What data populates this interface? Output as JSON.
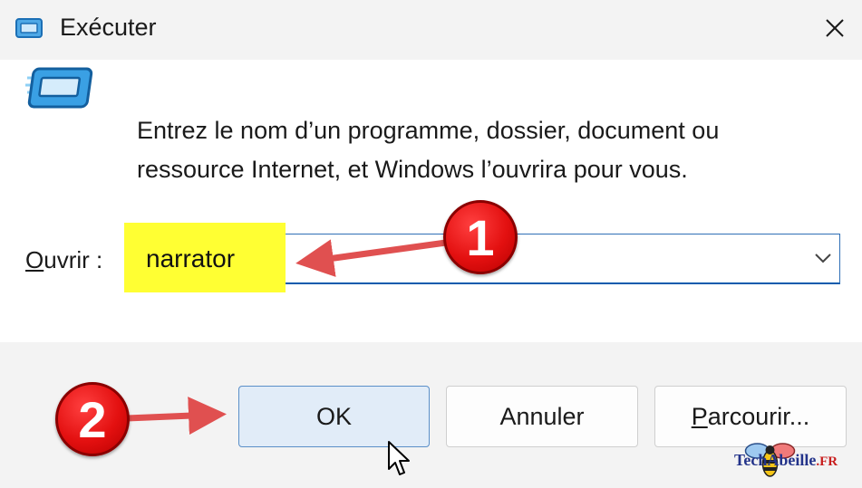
{
  "window": {
    "title": "Exécuter",
    "icon": "run-icon"
  },
  "dialog": {
    "description": "Entrez le nom d’un programme, dossier, document ou ressource Internet, et Windows l’ouvrira pour vous.",
    "open_label_mnemonic": "O",
    "open_label_rest": "uvrir :",
    "combo_value": "narrator"
  },
  "buttons": {
    "ok": "OK",
    "cancel": "Annuler",
    "browse_mnemonic": "P",
    "browse_rest": "arcourir..."
  },
  "annotations": {
    "step1": "1",
    "step2": "2"
  },
  "watermark": {
    "brand": "TechAbeille",
    "suffix": ".FR"
  },
  "colors": {
    "highlight": "#ffff33",
    "badge": "#e31010",
    "arrow": "#e05050",
    "ok_button_bg": "#e1ecf8",
    "accent_border": "#0b5cad"
  }
}
